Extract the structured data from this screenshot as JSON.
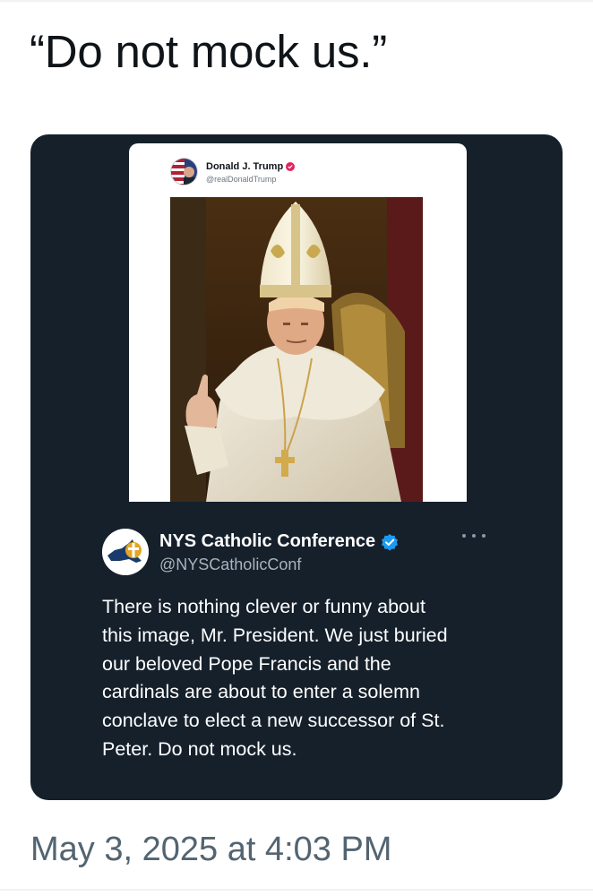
{
  "post": {
    "text": "“Do not mock us.”",
    "timestamp": "May 3, 2025 at 4:03 PM"
  },
  "quoted": {
    "author_name": "NYS Catholic Conference",
    "author_handle": "@NYSCatholicConf",
    "verified": true,
    "text_lines": [
      "There is nothing clever or funny about",
      "this image, Mr. President. We just buried",
      "our beloved Pope Francis and the",
      "cardinals are about to enter a solemn",
      "conclave to elect a new successor of St.",
      "Peter. Do not mock us."
    ],
    "more_icon": "more-horizontal-icon"
  },
  "embedded_screenshot": {
    "author_name": "Donald J. Trump",
    "author_handle": "@realDonaldTrump",
    "verified_badge_color": "#e0245e",
    "image_alt_icon": "pope-figure-image"
  },
  "colors": {
    "card_bg": "#15202b",
    "verified_blue": "#1d9bf0",
    "timestamp": "#536471"
  }
}
